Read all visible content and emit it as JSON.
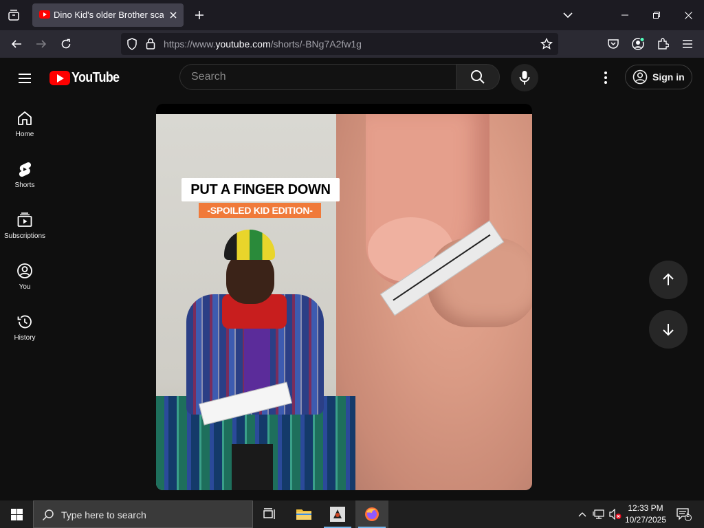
{
  "browser": {
    "tab": {
      "title": "Dino Kid's older Brother scared"
    },
    "url": {
      "prefix": "https://www.",
      "domain": "youtube.com",
      "path": "/shorts/-BNg7A2fw1g"
    }
  },
  "youtube": {
    "logo_text": "YouTube",
    "search": {
      "placeholder": "Search"
    },
    "sign_in_label": "Sign in",
    "guide": [
      {
        "label": "Home",
        "icon": "home-icon"
      },
      {
        "label": "Shorts",
        "icon": "shorts-icon"
      },
      {
        "label": "Subscriptions",
        "icon": "subscriptions-icon"
      },
      {
        "label": "You",
        "icon": "account-circle-icon"
      },
      {
        "label": "History",
        "icon": "history-icon"
      }
    ],
    "short": {
      "overlay_title": "PUT A FINGER DOWN",
      "overlay_subtitle": "-SPOILED KID EDITION-"
    }
  },
  "taskbar": {
    "search_placeholder": "Type here to search",
    "time": "12:33 PM",
    "date": "10/27/2025",
    "notification_count": "1"
  },
  "colors": {
    "youtube_bg": "#0f0f0f",
    "youtube_red": "#ff0000",
    "browser_tabstrip": "#1c1b22",
    "browser_toolbar": "#2b2a33",
    "overlay_orange": "#f07a3a"
  }
}
